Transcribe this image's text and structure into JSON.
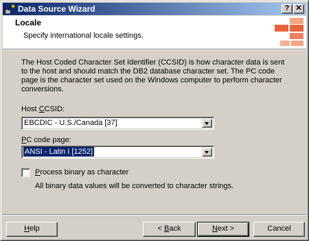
{
  "window": {
    "title": "Data Source Wizard",
    "help_glyph": "?",
    "close_glyph": "✕",
    "icon": "wizard-wand-icon"
  },
  "header": {
    "title": "Locale",
    "subtitle": "Specify international locale settings.",
    "logo": "orange-blocks-logo"
  },
  "body": {
    "description": "The Host Coded Character Set Identifier (CCSID) is how character data is sent to the host and should match the DB2 database character set. The PC code page is the character set used on the Windows computer to perform character conversions.",
    "host_ccsid": {
      "label_pre": "Host ",
      "label_accel": "C",
      "label_post": "CSID:",
      "value": "EBCDIC - U.S./Canada [37]"
    },
    "pc_code_page": {
      "label_pre": "",
      "label_accel": "P",
      "label_post": "C code page:",
      "value": "ANSI - Latin I [1252]"
    },
    "process_binary": {
      "label_pre": "",
      "label_accel": "P",
      "label_post": "rocess binary as character",
      "checked": false,
      "note": "All binary data values will be converted to character strings."
    }
  },
  "buttons": {
    "help": {
      "accel": "H",
      "rest": "elp"
    },
    "back": {
      "pre": "< ",
      "accel": "B",
      "rest": "ack"
    },
    "next": {
      "accel": "N",
      "rest": "ext >"
    },
    "cancel": "Cancel"
  },
  "colors": {
    "title_start": "#0a246a",
    "title_end": "#a6caf0",
    "face": "#d4d0c8",
    "selection": "#0a246a",
    "logo_orange": "#e8643c"
  }
}
